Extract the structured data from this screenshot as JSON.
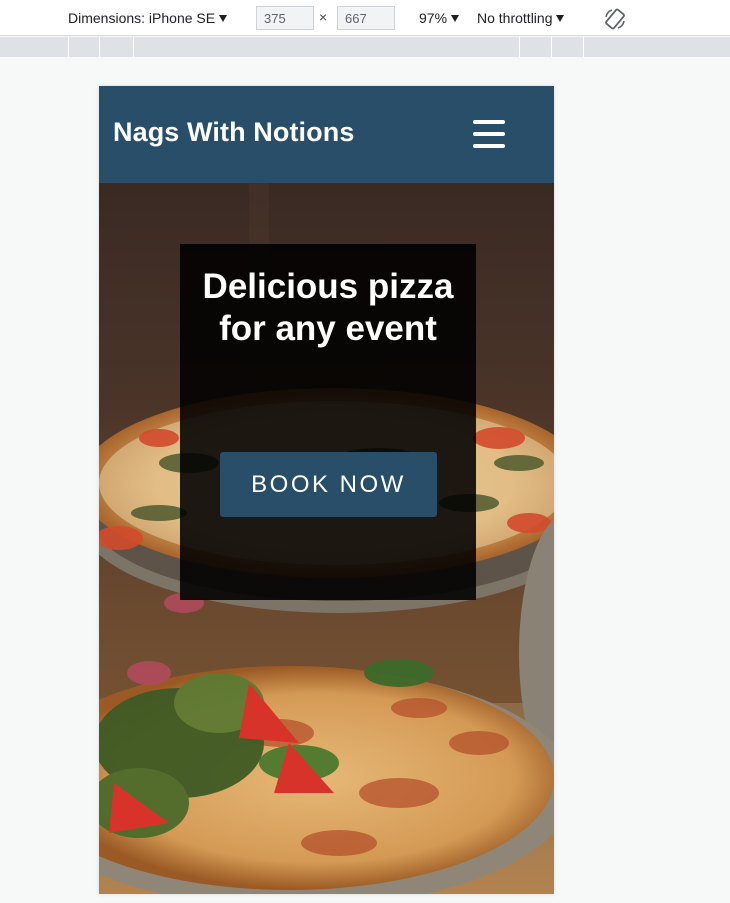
{
  "devtools": {
    "dimensions_label": "Dimensions: iPhone SE",
    "width_value": "375",
    "times_symbol": "×",
    "height_value": "667",
    "zoom_label": "97%",
    "throttling_label": "No throttling",
    "rotate_icon": "rotate-icon"
  },
  "site": {
    "title": "Nags With Notions",
    "menu_icon": "hamburger-menu-icon",
    "header_color": "#284e69"
  },
  "hero": {
    "headline": "Delicious pizza for any event",
    "button_label": "BOOK NOW",
    "background_image": "pizza-photo"
  }
}
